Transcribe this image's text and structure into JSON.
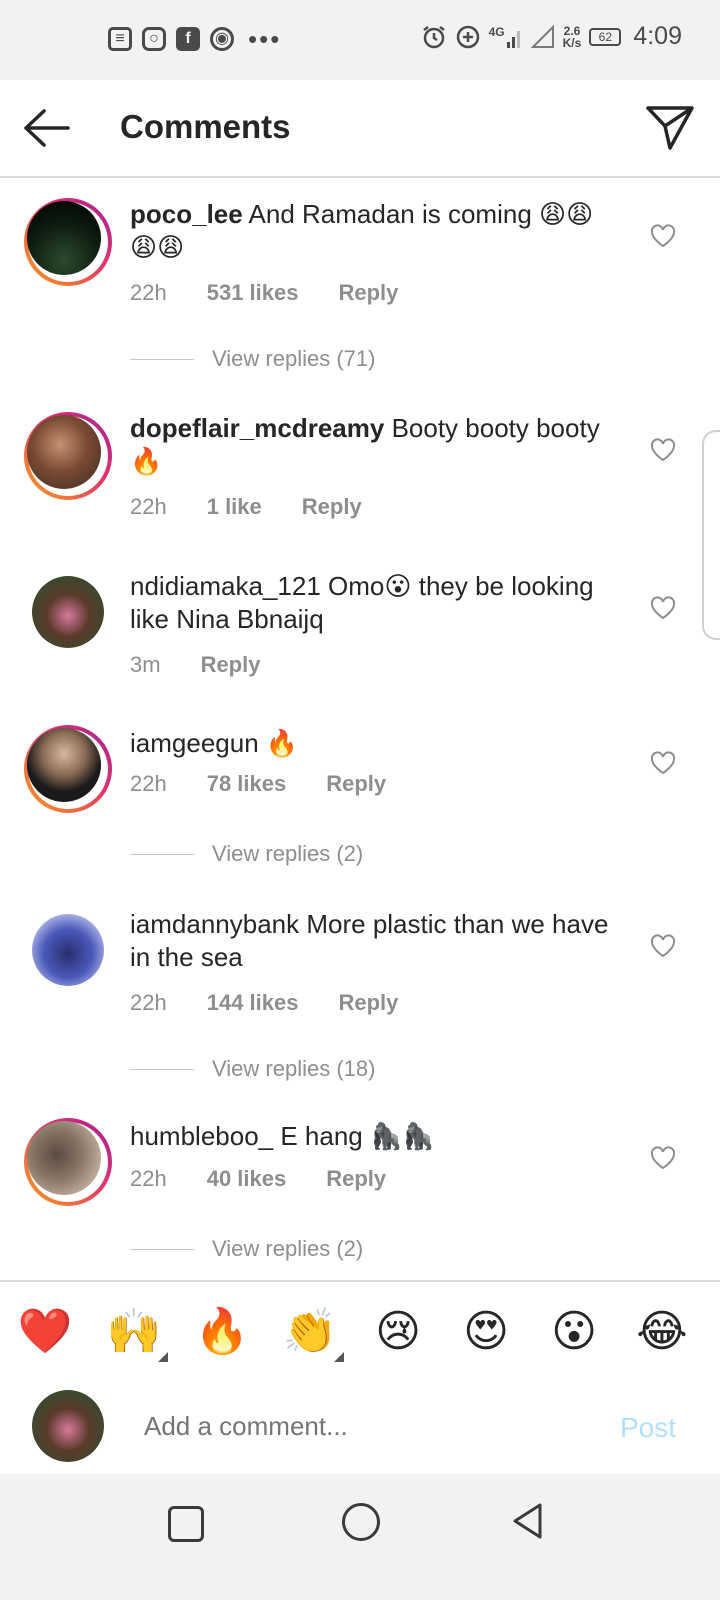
{
  "status_bar": {
    "net_type": "4G",
    "speed_value": "2.6",
    "speed_unit": "K/s",
    "battery": "62",
    "time": "4:09",
    "icons": [
      "news-icon",
      "instagram-icon",
      "facebook-icon",
      "chrome-icon",
      "more-dots-icon",
      "alarm-icon",
      "data-saver-icon",
      "signal-icon",
      "wifi-icon",
      "battery-icon"
    ]
  },
  "header": {
    "title": "Comments"
  },
  "comments": [
    {
      "username": "poco_lee",
      "text": "And Ramadan is coming 😩😩😩😩",
      "time": "22h",
      "likes": "531 likes",
      "reply": "Reply",
      "view_replies": "View replies (71)"
    },
    {
      "username": "dopeflair_mcdreamy",
      "text": "Booty booty booty 🔥",
      "time": "22h",
      "likes": "1 like",
      "reply": "Reply"
    },
    {
      "username": "ndidiamaka_121",
      "text": "Omo😮 they be looking like Nina Bbnaijq",
      "time": "3m",
      "reply": "Reply"
    },
    {
      "username": "iamgeegun",
      "text": "🔥",
      "time": "22h",
      "likes": "78 likes",
      "reply": "Reply",
      "view_replies": "View replies (2)"
    },
    {
      "username": "iamdannybank",
      "text": "More plastic than we have in the sea",
      "time": "22h",
      "likes": "144 likes",
      "reply": "Reply",
      "view_replies": "View replies (18)"
    },
    {
      "username": "humbleboo_",
      "text": "E hang 🦍🦍",
      "time": "22h",
      "likes": "40 likes",
      "reply": "Reply",
      "view_replies": "View replies (2)"
    }
  ],
  "emoji_bar": [
    "❤️",
    "🙌",
    "🔥",
    "👏",
    "😢",
    "😍",
    "😮",
    "😂"
  ],
  "input": {
    "placeholder": "Add a comment...",
    "post_label": "Post"
  },
  "colors": {
    "ring_gradient_start": "#f9a31c",
    "ring_gradient_end": "#a0239a",
    "post_disabled": "#b2dffc",
    "meta_gray": "#8e8e8e"
  }
}
